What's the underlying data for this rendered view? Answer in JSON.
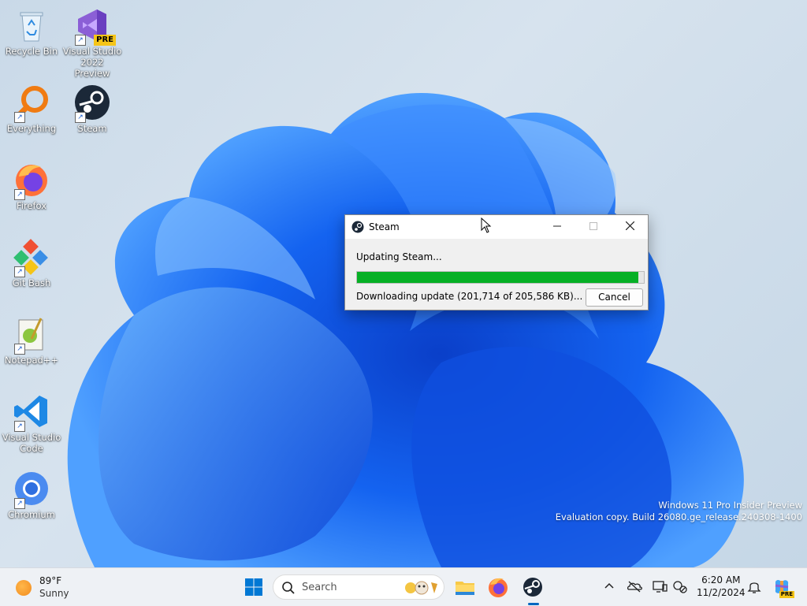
{
  "desktop": {
    "icons": [
      {
        "label": "Recycle Bin",
        "icon": "recycle-bin-icon"
      },
      {
        "label": "Visual Studio 2022 Preview",
        "line1": "Visual Studio",
        "line2": "2022 Preview",
        "badge": "PRE",
        "icon": "visual-studio-icon"
      },
      {
        "label": "Everything",
        "icon": "everything-search-icon"
      },
      {
        "label": "Steam",
        "icon": "steam-icon"
      },
      {
        "label": "Firefox",
        "icon": "firefox-icon"
      },
      {
        "label": "Git Bash",
        "icon": "git-bash-icon"
      },
      {
        "label": "Notepad++",
        "icon": "notepad-plus-plus-icon"
      },
      {
        "label": "Visual Studio Code",
        "line1": "Visual Studio",
        "line2": "Code",
        "icon": "vscode-icon"
      },
      {
        "label": "Chromium",
        "icon": "chromium-icon"
      }
    ],
    "watermark": {
      "line1": "Windows 11 Pro Insider Preview",
      "line2": "Evaluation copy. Build 26080.ge_release.240308-1400"
    }
  },
  "dialog": {
    "title": "Steam",
    "status": "Updating Steam...",
    "progress_fraction": 0.981,
    "download_text": "Downloading update (201,714 of 205,586 KB)...",
    "cancel_label": "Cancel",
    "colors": {
      "progress": "#06b025"
    }
  },
  "taskbar": {
    "weather": {
      "temp": "89°F",
      "condition": "Sunny"
    },
    "search_placeholder": "Search",
    "clock": {
      "time": "6:20 AM",
      "date": "11/2/2024"
    },
    "pinned": [
      "windows-start-icon",
      "file-explorer-icon",
      "firefox-icon",
      "steam-icon"
    ],
    "tray": [
      "chevron-up-icon",
      "onedrive-icon",
      "display-icon",
      "network-icon",
      "bell-icon",
      "copilot-icon"
    ],
    "copilot_badge": "PRE"
  }
}
